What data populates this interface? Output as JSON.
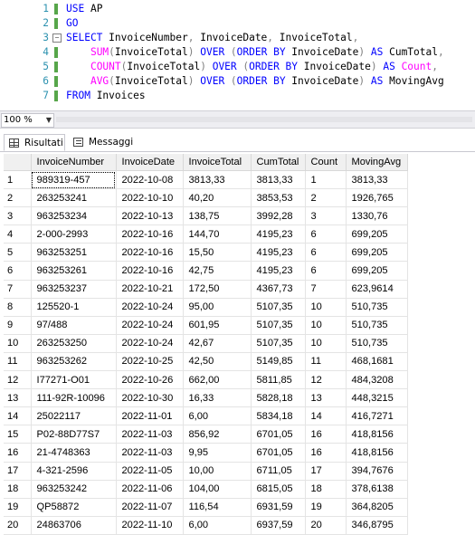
{
  "editor": {
    "lines": [
      {
        "n": "1",
        "segs": [
          [
            "kw",
            "USE "
          ],
          [
            "pl",
            "AP"
          ]
        ]
      },
      {
        "n": "2",
        "segs": [
          [
            "kw",
            "GO"
          ]
        ]
      },
      {
        "n": "3",
        "segs": [
          [
            "kw",
            "SELECT "
          ],
          [
            "pl",
            "InvoiceNumber"
          ],
          [
            "op",
            ", "
          ],
          [
            "pl",
            "InvoiceDate"
          ],
          [
            "op",
            ", "
          ],
          [
            "pl",
            "InvoiceTotal"
          ],
          [
            "op",
            ","
          ]
        ]
      },
      {
        "n": "4",
        "segs": [
          [
            "pl",
            "    "
          ],
          [
            "fn",
            "SUM"
          ],
          [
            "op",
            "("
          ],
          [
            "pl",
            "InvoiceTotal"
          ],
          [
            "op",
            ") "
          ],
          [
            "kw",
            "OVER "
          ],
          [
            "op",
            "("
          ],
          [
            "kw",
            "ORDER BY "
          ],
          [
            "pl",
            "InvoiceDate"
          ],
          [
            "op",
            ") "
          ],
          [
            "kw",
            "AS "
          ],
          [
            "pl",
            "CumTotal"
          ],
          [
            "op",
            ","
          ]
        ]
      },
      {
        "n": "5",
        "segs": [
          [
            "pl",
            "    "
          ],
          [
            "fn",
            "COUNT"
          ],
          [
            "op",
            "("
          ],
          [
            "pl",
            "InvoiceTotal"
          ],
          [
            "op",
            ") "
          ],
          [
            "kw",
            "OVER "
          ],
          [
            "op",
            "("
          ],
          [
            "kw",
            "ORDER BY "
          ],
          [
            "pl",
            "InvoiceDate"
          ],
          [
            "op",
            ") "
          ],
          [
            "kw",
            "AS "
          ],
          [
            "fn",
            "Count"
          ],
          [
            "op",
            ","
          ]
        ]
      },
      {
        "n": "6",
        "segs": [
          [
            "pl",
            "    "
          ],
          [
            "fn",
            "AVG"
          ],
          [
            "op",
            "("
          ],
          [
            "pl",
            "InvoiceTotal"
          ],
          [
            "op",
            ") "
          ],
          [
            "kw",
            "OVER "
          ],
          [
            "op",
            "("
          ],
          [
            "kw",
            "ORDER BY "
          ],
          [
            "pl",
            "InvoiceDate"
          ],
          [
            "op",
            ") "
          ],
          [
            "kw",
            "AS "
          ],
          [
            "pl",
            "MovingAvg"
          ]
        ]
      },
      {
        "n": "7",
        "segs": [
          [
            "kw",
            "FROM "
          ],
          [
            "pl",
            "Invoices"
          ]
        ]
      }
    ]
  },
  "zoom": {
    "value": "100 %"
  },
  "tabs": {
    "results": "Risultati",
    "messages": "Messaggi"
  },
  "grid": {
    "columns": [
      "",
      "InvoiceNumber",
      "InvoiceDate",
      "InvoiceTotal",
      "CumTotal",
      "Count",
      "MovingAvg"
    ],
    "rows": [
      [
        "1",
        "989319-457",
        "2022-10-08",
        "3813,33",
        "3813,33",
        "1",
        "3813,33"
      ],
      [
        "2",
        "263253241",
        "2022-10-10",
        "40,20",
        "3853,53",
        "2",
        "1926,765"
      ],
      [
        "3",
        "963253234",
        "2022-10-13",
        "138,75",
        "3992,28",
        "3",
        "1330,76"
      ],
      [
        "4",
        "2-000-2993",
        "2022-10-16",
        "144,70",
        "4195,23",
        "6",
        "699,205"
      ],
      [
        "5",
        "963253251",
        "2022-10-16",
        "15,50",
        "4195,23",
        "6",
        "699,205"
      ],
      [
        "6",
        "963253261",
        "2022-10-16",
        "42,75",
        "4195,23",
        "6",
        "699,205"
      ],
      [
        "7",
        "963253237",
        "2022-10-21",
        "172,50",
        "4367,73",
        "7",
        "623,9614"
      ],
      [
        "8",
        "125520-1",
        "2022-10-24",
        "95,00",
        "5107,35",
        "10",
        "510,735"
      ],
      [
        "9",
        "97/488",
        "2022-10-24",
        "601,95",
        "5107,35",
        "10",
        "510,735"
      ],
      [
        "10",
        "263253250",
        "2022-10-24",
        "42,67",
        "5107,35",
        "10",
        "510,735"
      ],
      [
        "11",
        "963253262",
        "2022-10-25",
        "42,50",
        "5149,85",
        "11",
        "468,1681"
      ],
      [
        "12",
        "I77271-O01",
        "2022-10-26",
        "662,00",
        "5811,85",
        "12",
        "484,3208"
      ],
      [
        "13",
        "111-92R-10096",
        "2022-10-30",
        "16,33",
        "5828,18",
        "13",
        "448,3215"
      ],
      [
        "14",
        "25022117",
        "2022-11-01",
        "6,00",
        "5834,18",
        "14",
        "416,7271"
      ],
      [
        "15",
        "P02-88D77S7",
        "2022-11-03",
        "856,92",
        "6701,05",
        "16",
        "418,8156"
      ],
      [
        "16",
        "21-4748363",
        "2022-11-03",
        "9,95",
        "6701,05",
        "16",
        "418,8156"
      ],
      [
        "17",
        "4-321-2596",
        "2022-11-05",
        "10,00",
        "6711,05",
        "17",
        "394,7676"
      ],
      [
        "18",
        "963253242",
        "2022-11-06",
        "104,00",
        "6815,05",
        "18",
        "378,6138"
      ],
      [
        "19",
        "QP58872",
        "2022-11-07",
        "116,54",
        "6931,59",
        "19",
        "364,8205"
      ],
      [
        "20",
        "24863706",
        "2022-11-10",
        "6,00",
        "6937,59",
        "20",
        "346,8795"
      ]
    ]
  }
}
